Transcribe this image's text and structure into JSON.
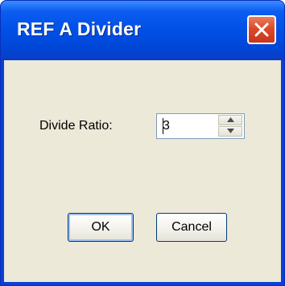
{
  "window": {
    "title": "REF A Divider",
    "close_icon": "close-icon"
  },
  "form": {
    "divide_ratio_label": "Divide Ratio:",
    "divide_ratio_value": "3",
    "spin_up_icon": "triangle-up-icon",
    "spin_down_icon": "triangle-down-icon"
  },
  "buttons": {
    "ok_label": "OK",
    "cancel_label": "Cancel"
  },
  "colors": {
    "titlebar": "#0050e6",
    "client_background": "#ece9d8",
    "close_button": "#dd4a2a",
    "button_border": "#003c74"
  }
}
